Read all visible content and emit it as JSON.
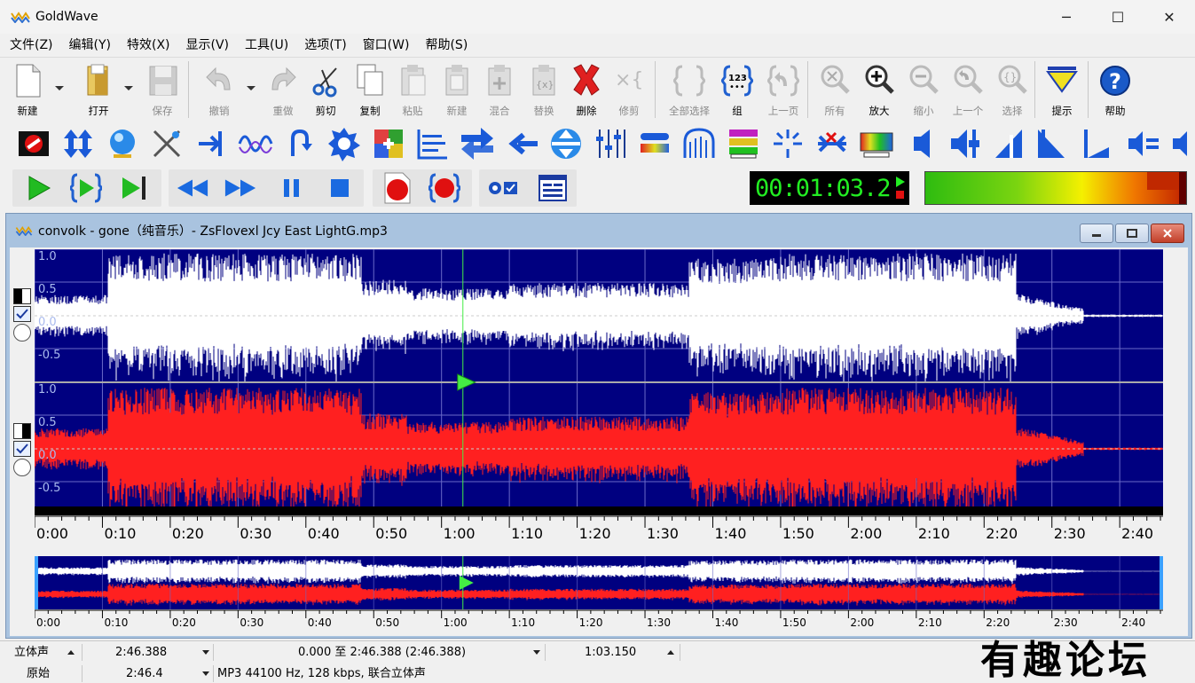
{
  "window": {
    "title": "GoldWave",
    "minimize_icon": "─",
    "maximize_icon": "☐",
    "close_icon": "✕"
  },
  "menu": [
    "文件(Z)",
    "编辑(Y)",
    "特效(X)",
    "显示(V)",
    "工具(U)",
    "选项(T)",
    "窗口(W)",
    "帮助(S)"
  ],
  "toolbar": {
    "buttons": [
      {
        "label": "新建",
        "icon": "new-file-icon",
        "enabled": true
      },
      {
        "label": "打开",
        "icon": "open-folder-icon",
        "enabled": true
      },
      {
        "label": "保存",
        "icon": "save-disk-icon",
        "enabled": false
      },
      {
        "label": "撤销",
        "icon": "undo-icon",
        "enabled": false
      },
      {
        "label": "重做",
        "icon": "redo-icon",
        "enabled": false
      },
      {
        "label": "剪切",
        "icon": "scissors-icon",
        "enabled": true
      },
      {
        "label": "复制",
        "icon": "copy-icon",
        "enabled": true
      },
      {
        "label": "粘贴",
        "icon": "paste-icon",
        "enabled": false
      },
      {
        "label": "新建",
        "icon": "paste-new-icon",
        "enabled": false
      },
      {
        "label": "混合",
        "icon": "mix-icon",
        "enabled": false
      },
      {
        "label": "替换",
        "icon": "replace-icon",
        "enabled": false
      },
      {
        "label": "删除",
        "icon": "delete-x-icon",
        "enabled": true
      },
      {
        "label": "修剪",
        "icon": "trim-icon",
        "enabled": false
      },
      {
        "label": "全部选择",
        "icon": "select-all-icon",
        "enabled": false
      },
      {
        "label": "组",
        "icon": "group-123-icon",
        "enabled": true
      },
      {
        "label": "上一页",
        "icon": "previous-page-icon",
        "enabled": false
      },
      {
        "label": "所有",
        "icon": "zoom-all-icon",
        "enabled": false
      },
      {
        "label": "放大",
        "icon": "zoom-in-icon",
        "enabled": true
      },
      {
        "label": "缩小",
        "icon": "zoom-out-icon",
        "enabled": false
      },
      {
        "label": "上一个",
        "icon": "zoom-previous-icon",
        "enabled": false
      },
      {
        "label": "选择",
        "icon": "zoom-selection-icon",
        "enabled": false
      },
      {
        "label": "提示",
        "icon": "hint-triangle-icon",
        "enabled": true
      },
      {
        "label": "帮助",
        "icon": "help-question-icon",
        "enabled": true
      }
    ]
  },
  "effects_toolbar": [
    "no-entry-icon",
    "resize-vertical-icon",
    "sphere-icon",
    "xy-cross-icon",
    "input-arrow-icon",
    "wave-icon",
    "return-arrow-icon",
    "gear-icon",
    "color-mix-icon",
    "equalizer-icon",
    "double-arrow-icon",
    "left-arrow-icon",
    "up-down-circle-icon",
    "sliders-icon",
    "spectrum-bar-icon",
    "arch-icon",
    "color-grid-icon",
    "split-line-icon",
    "cut-merge-icon",
    "rainbow-box-icon",
    "speaker-icon",
    "speaker-fader-icon",
    "speaker-loud-icon",
    "speaker-mute-icon",
    "speaker-small-icon",
    "speaker-equal-icon",
    "speaker-partial-icon"
  ],
  "transport": {
    "buttons": [
      "play-icon",
      "play-selection-icon",
      "play-to-end-icon",
      "rewind-icon",
      "fast-forward-icon",
      "pause-icon",
      "stop-icon",
      "record-icon",
      "record-selection-icon",
      "monitor-record-icon",
      "control-window-icon"
    ],
    "time_display": "00:01:03.2"
  },
  "document": {
    "title": "convolk - gone（纯音乐）- ZsFlovexl Jcy East LightG.mp3",
    "colors": {
      "waveform_background": "#000080",
      "left_channel": "#ffffff",
      "right_channel": "#ff2020",
      "grid": "#6a6ac8",
      "playhead": "#44ee44"
    },
    "channel_axis_labels": [
      "1.0",
      "0.5",
      "0.0",
      "-0.5"
    ],
    "timeline_labels": [
      "0:00",
      "0:10",
      "0:20",
      "0:30",
      "0:40",
      "0:50",
      "1:00",
      "1:10",
      "1:20",
      "1:30",
      "1:40",
      "1:50",
      "2:00",
      "2:10",
      "2:20",
      "2:30",
      "2:40"
    ],
    "duration_seconds": 166.388,
    "playhead_seconds": 63.15
  },
  "status": {
    "row1": {
      "channel": "立体声",
      "length": "2:46.388",
      "selection": "0.000 至 2:46.388 (2:46.388)",
      "position": "1:03.150"
    },
    "row2": {
      "mode": "原始",
      "size": "2:46.4",
      "format": "MP3 44100 Hz, 128 kbps, 联合立体声"
    }
  },
  "watermark": "有趣论坛"
}
